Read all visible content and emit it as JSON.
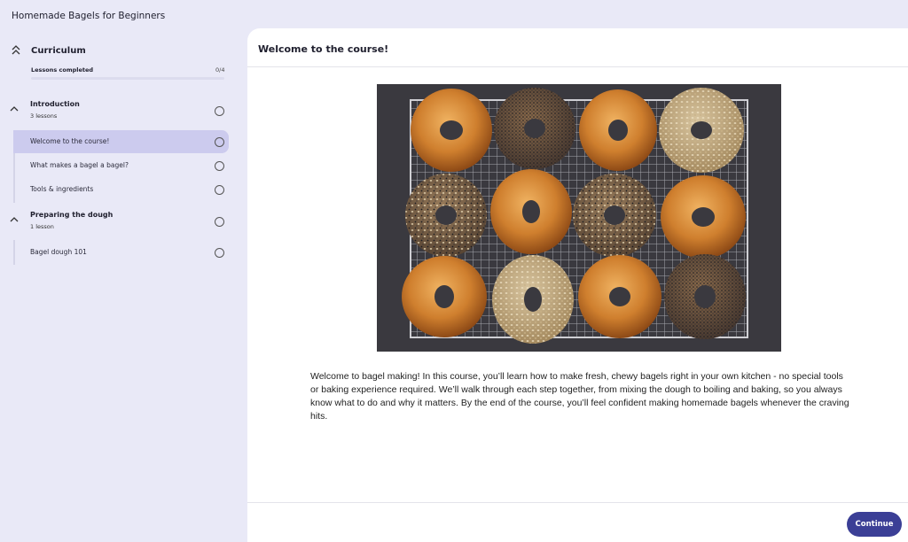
{
  "app": {
    "title": "Homemade Bagels for Beginners"
  },
  "sidebar": {
    "curriculum_title": "Curriculum",
    "lessons_completed_label": "Lessons completed",
    "lessons_completed_count": "0/4",
    "progress_fraction": 0,
    "sections": [
      {
        "title": "Introduction",
        "subtitle": "3 lessons",
        "lessons": [
          {
            "label": "Welcome to the course!",
            "active": true
          },
          {
            "label": "What makes a bagel a bagel?",
            "active": false
          },
          {
            "label": "Tools & ingredients",
            "active": false
          }
        ]
      },
      {
        "title": "Preparing the dough",
        "subtitle": "1 lesson",
        "lessons": [
          {
            "label": "Bagel dough 101",
            "active": false
          }
        ]
      }
    ]
  },
  "main": {
    "title": "Welcome to the course!",
    "body": "Welcome to bagel making! In this course, you’ll learn how to make fresh, chewy bagels right in your own kitchen - no special tools or baking experience required. We’ll walk through each step together, from mixing the dough to boiling and baking, so you always know what to do and why it matters. By the end of the course, you’ll feel confident making homemade bagels whenever the craving hits.",
    "continue_label": "Continue"
  },
  "colors": {
    "accent": "#3b3f96",
    "active_lesson_bg": "#cccbee",
    "sidebar_bg": "#e9e9f7"
  },
  "icons": {
    "collapse": "double-chevron-up-icon",
    "section_toggle": "chevron-up-icon",
    "lesson_status": "empty-circle-icon"
  }
}
